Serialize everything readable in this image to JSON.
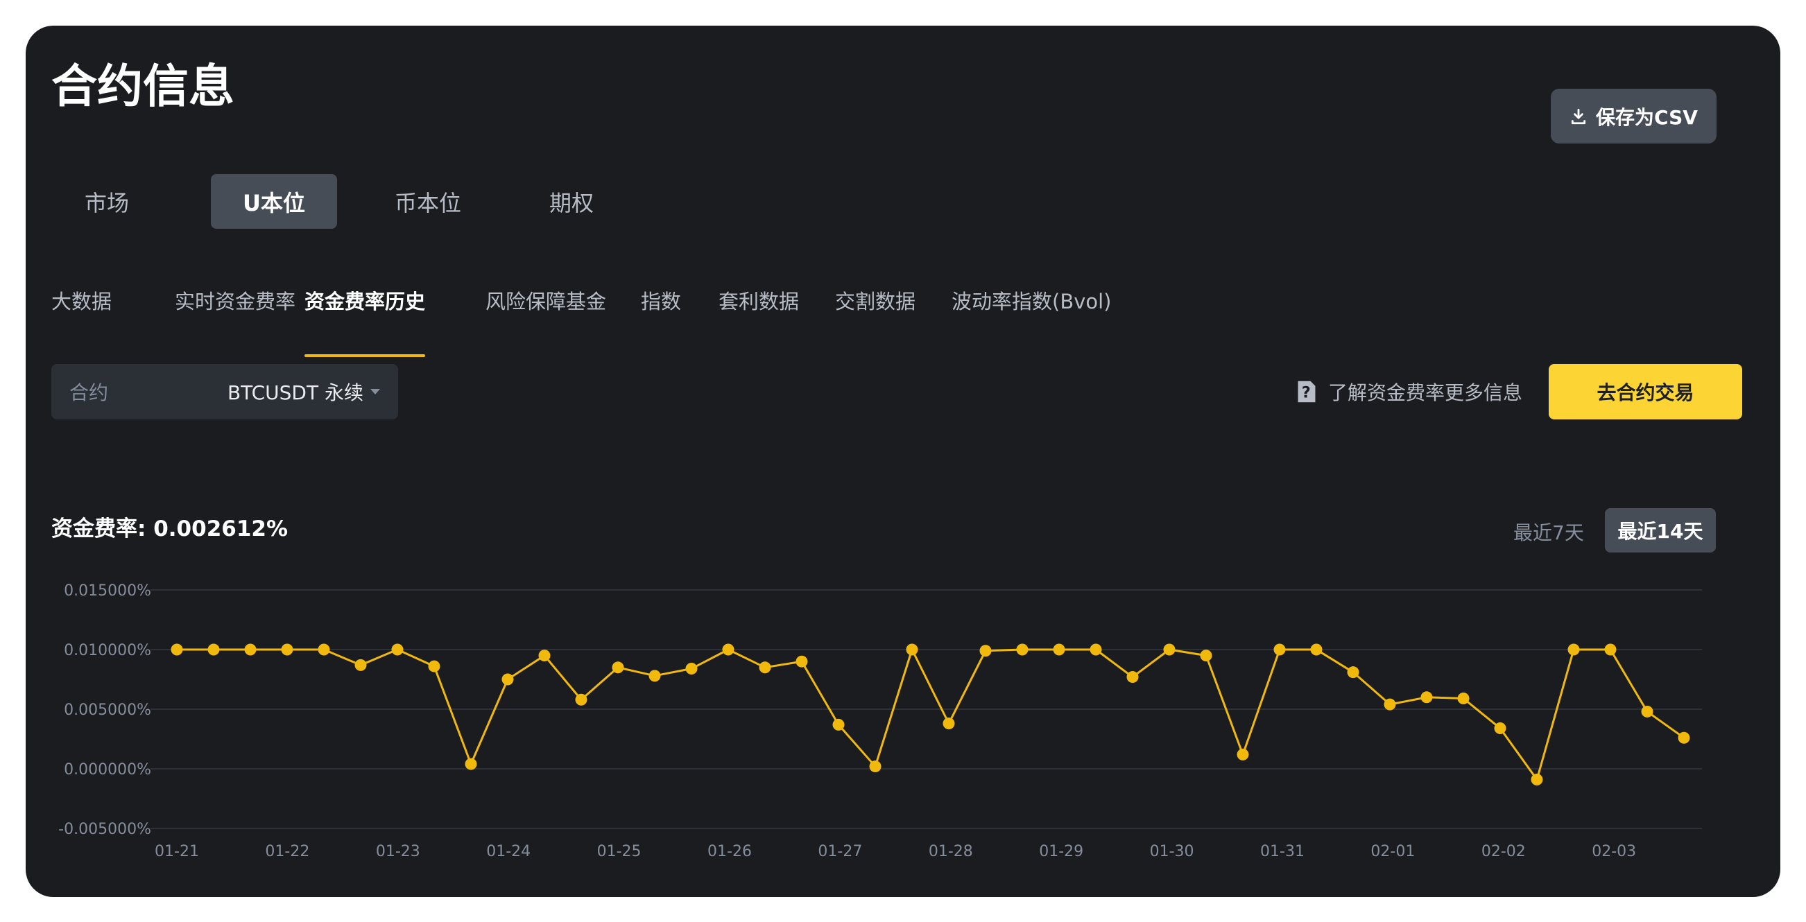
{
  "page": {
    "title": "合约信息"
  },
  "toolbar": {
    "save_csv_label": "保存为CSV"
  },
  "market_tabs": [
    {
      "label": "市场",
      "active": false
    },
    {
      "label": "U本位",
      "active": true
    },
    {
      "label": "币本位",
      "active": false
    },
    {
      "label": "期权",
      "active": false
    }
  ],
  "sub_tabs": [
    {
      "label": "大数据",
      "active": false
    },
    {
      "label": "实时资金费率",
      "active": false
    },
    {
      "label": "资金费率历史",
      "active": true
    },
    {
      "label": "风险保障基金",
      "active": false
    },
    {
      "label": "指数",
      "active": false
    },
    {
      "label": "套利数据",
      "active": false
    },
    {
      "label": "交割数据",
      "active": false
    },
    {
      "label": "波动率指数(Bvol)",
      "active": false
    }
  ],
  "contract": {
    "label": "合约",
    "value": "BTCUSDT 永续"
  },
  "links": {
    "learn_more": "了解资金费率更多信息"
  },
  "actions": {
    "trade_label": "去合约交易"
  },
  "funding": {
    "label": "资金费率:",
    "value": "0.002612%"
  },
  "range": {
    "option_7d": "最近7天",
    "option_14d": "最近14天",
    "selected": "最近14天"
  },
  "colors": {
    "accent": "#f0b90b",
    "background": "#1b1c20",
    "button": "#474d57",
    "primary_button": "#fcd535"
  },
  "icons": {
    "download": "download-icon",
    "question": "question-doc-icon",
    "caret": "caret-down-icon"
  },
  "chart_data": {
    "type": "line",
    "ylim": [
      -0.005,
      0.015
    ],
    "yticks": [
      0.015,
      0.01,
      0.005,
      0.0,
      -0.005
    ],
    "ytick_labels": [
      "0.015000%",
      "0.010000%",
      "0.005000%",
      "0.000000%",
      "-0.005000%"
    ],
    "x_tick_labels": [
      "01-21",
      "01-22",
      "01-23",
      "01-24",
      "01-25",
      "01-26",
      "01-27",
      "01-28",
      "01-29",
      "01-30",
      "01-31",
      "02-01",
      "02-02",
      "02-03"
    ],
    "grid": true,
    "series": [
      {
        "color": "#f0b90b",
        "values": [
          0.01,
          0.01,
          0.01,
          0.01,
          0.01,
          0.0087,
          0.01,
          0.0086,
          0.0004,
          0.0075,
          0.0095,
          0.0058,
          0.0085,
          0.0078,
          0.0084,
          0.01,
          0.0085,
          0.009,
          0.0037,
          0.0002,
          0.01,
          0.0038,
          0.0099,
          0.01,
          0.01,
          0.01,
          0.0077,
          0.01,
          0.0095,
          0.0012,
          0.01,
          0.01,
          0.0081,
          0.0054,
          0.006,
          0.0059,
          0.0034,
          -0.0009,
          0.01,
          0.01,
          0.0048,
          0.0026
        ]
      }
    ]
  }
}
